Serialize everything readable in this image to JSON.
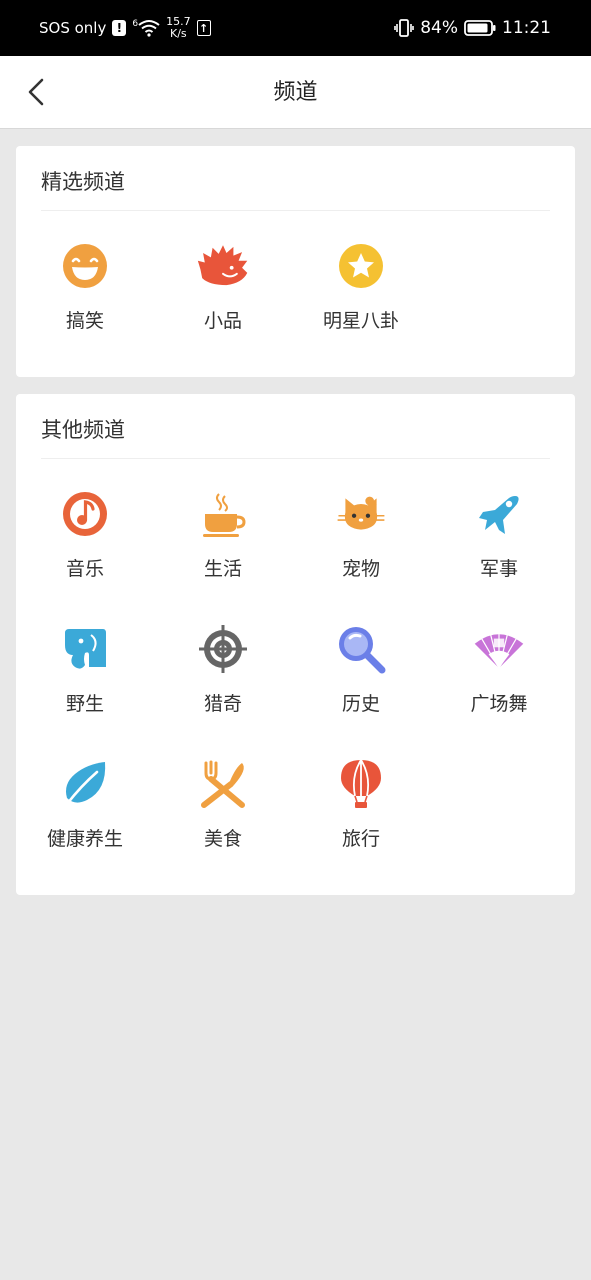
{
  "status": {
    "carrier": "SOS only",
    "net_gen": "6",
    "speed_top": "15.7",
    "speed_bottom": "K/s",
    "battery": "84%",
    "time": "11:21"
  },
  "header": {
    "title": "频道",
    "back_icon": "chevron-left-icon"
  },
  "featured": {
    "title": "精选频道",
    "items": [
      {
        "label": "搞笑",
        "icon": "laughing-face-icon",
        "color": "#f0a040"
      },
      {
        "label": "小品",
        "icon": "hedgehog-icon",
        "color": "#e8553a"
      },
      {
        "label": "明星八卦",
        "icon": "star-badge-icon",
        "color": "#f5c132"
      }
    ]
  },
  "other": {
    "title": "其他频道",
    "items": [
      {
        "label": "音乐",
        "icon": "music-note-icon",
        "color": "#e8643a"
      },
      {
        "label": "生活",
        "icon": "coffee-cup-icon",
        "color": "#f0a040"
      },
      {
        "label": "宠物",
        "icon": "cat-face-icon",
        "color": "#f0a040"
      },
      {
        "label": "军事",
        "icon": "jet-plane-icon",
        "color": "#3ba9d8"
      },
      {
        "label": "野生",
        "icon": "elephant-icon",
        "color": "#3ba9d8"
      },
      {
        "label": "猎奇",
        "icon": "crosshair-icon",
        "color": "#666666"
      },
      {
        "label": "历史",
        "icon": "magnifier-icon",
        "color": "#6b7fe8"
      },
      {
        "label": "广场舞",
        "icon": "folding-fan-icon",
        "color": "#c874d8"
      },
      {
        "label": "健康养生",
        "icon": "leaf-icon",
        "color": "#3ba9d8"
      },
      {
        "label": "美食",
        "icon": "fork-knife-icon",
        "color": "#f0a040"
      },
      {
        "label": "旅行",
        "icon": "hot-air-balloon-icon",
        "color": "#e8553a"
      }
    ]
  }
}
